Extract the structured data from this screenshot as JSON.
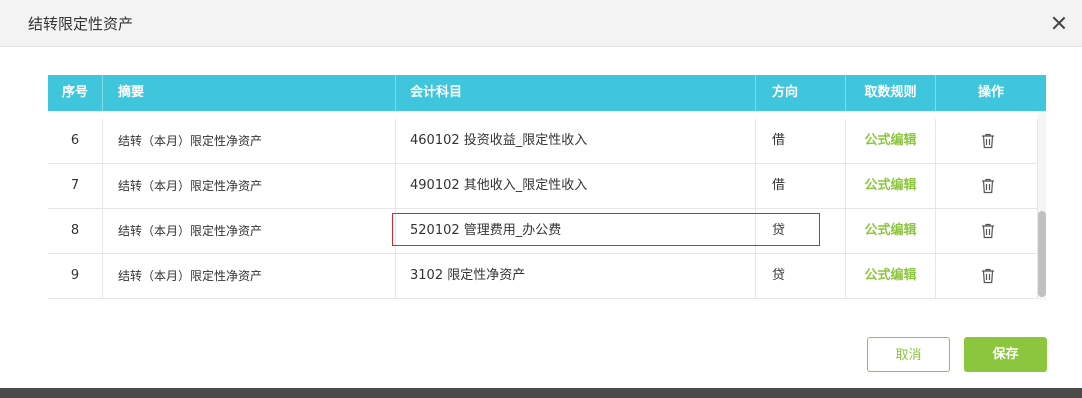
{
  "dialog": {
    "title": "结转限定性资产"
  },
  "table": {
    "headers": {
      "no": "序号",
      "summary": "摘要",
      "account": "会计科目",
      "direction": "方向",
      "rule": "取数规则",
      "op": "操作"
    },
    "rows": [
      {
        "no": "6",
        "summary": "结转（本月）限定性净资产",
        "account": "460102  投资收益_限定性收入",
        "direction": "借",
        "rule": "公式编辑"
      },
      {
        "no": "7",
        "summary": "结转（本月）限定性净资产",
        "account": "490102  其他收入_限定性收入",
        "direction": "借",
        "rule": "公式编辑"
      },
      {
        "no": "8",
        "summary": "结转（本月）限定性净资产",
        "account": "520102  管理费用_办公费",
        "direction": "贷",
        "rule": "公式编辑"
      },
      {
        "no": "9",
        "summary": "结转（本月）限定性净资产",
        "account": "3102  限定性净资产",
        "direction": "贷",
        "rule": "公式编辑"
      }
    ]
  },
  "buttons": {
    "cancel": "取消",
    "save": "保存"
  },
  "colors": {
    "header_bg": "#3fc6dc",
    "accent_green": "#8cc63f",
    "highlight_red": "#d9272e"
  }
}
